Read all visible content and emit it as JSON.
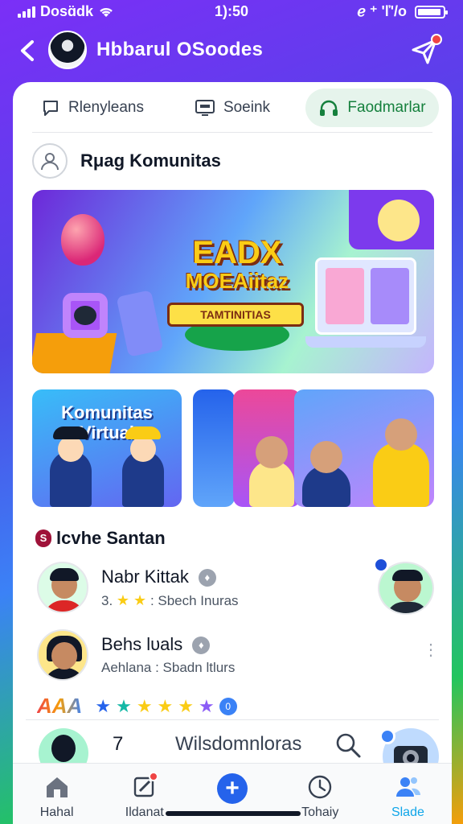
{
  "status_bar": {
    "carrier": "Dosɑ̈dk",
    "time": "1):50",
    "indicators": "ℯ ⁺ 'ľ'/o"
  },
  "header": {
    "title": "Hbbarul OSoodes",
    "back_icon": "chevron-left-icon",
    "send_icon": "paper-plane-icon"
  },
  "tabs": [
    {
      "label": "Rlenyleans",
      "icon": "comment-icon"
    },
    {
      "label": "Soeink",
      "icon": "screen-icon"
    },
    {
      "label": "Faodmarlar",
      "icon": "headphones-icon",
      "active": true
    }
  ],
  "section": {
    "title": "Rμag Komunitas"
  },
  "hero": {
    "title_line1": "EADX",
    "title_line2": "MOEAiitaz",
    "ribbon": "TAMTINITIAS"
  },
  "tiles": {
    "tile1_text": "Komunitas Virtual"
  },
  "list": {
    "head_icon": "S",
    "title": "lcvhe Santan",
    "rows": [
      {
        "name": "Nabr Kittak",
        "badge": "♦",
        "meta_prefix": "3.",
        "meta_suffix": ": Sbech Inuras",
        "stars": "★ ★"
      },
      {
        "name": "Behs lυals",
        "badge": "♦",
        "meta": "Aehlana : Sbadn ltlurs",
        "more": "⋮"
      }
    ]
  },
  "badges": {
    "logo": "AAA",
    "badge_num": "0"
  },
  "bottom_row": {
    "number": "7",
    "text": "Wilsdomnloras"
  },
  "nav": [
    {
      "label": "Hahal",
      "icon": "home-icon"
    },
    {
      "label": "Ildanat",
      "icon": "edit-icon"
    },
    {
      "label": "",
      "icon": "plus-icon"
    },
    {
      "label": "Tohaiy",
      "icon": "clock-icon"
    },
    {
      "label": "Slade",
      "icon": "people-icon",
      "active": true
    }
  ],
  "colors": {
    "accent": "#2563eb",
    "active_tab": "#15803d",
    "active_nav": "#0ea5e9",
    "badge_red": "#ef4444"
  }
}
